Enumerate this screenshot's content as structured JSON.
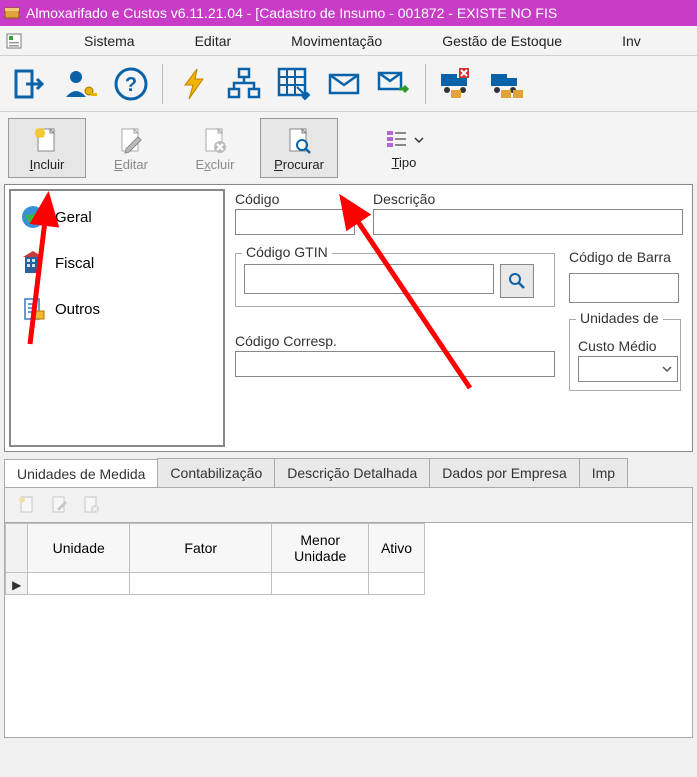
{
  "window": {
    "title": "Almoxarifado e Custos v6.11.21.04 - [Cadastro de Insumo - 001872 - EXISTE NO FIS"
  },
  "menubar": {
    "items": [
      "Sistema",
      "Editar",
      "Movimentação",
      "Gestão de Estoque",
      "Inv"
    ]
  },
  "action_toolbar": {
    "incluir": "Incluir",
    "editar": "Editar",
    "excluir": "Excluir",
    "procurar": "Procurar",
    "tipo": "Tipo"
  },
  "sidebar": {
    "items": [
      {
        "label": "Geral",
        "icon": "globe"
      },
      {
        "label": "Fiscal",
        "icon": "building"
      },
      {
        "label": "Outros",
        "icon": "document"
      }
    ]
  },
  "form": {
    "codigo_label": "Código",
    "descricao_label": "Descrição",
    "codigo_gtin_label": "Código GTIN",
    "codigo_barra_label": "Código de Barra",
    "unidades_de_label": "Unidades de ",
    "codigo_corresp_label": "Código Corresp.",
    "custo_medio_label": "Custo Médio",
    "codigo_value": "",
    "descricao_value": "",
    "gtin_value": "",
    "barra_value": "",
    "corresp_value": "",
    "custo_medio_value": ""
  },
  "tabs": {
    "items": [
      "Unidades de Medida",
      "Contabilização",
      "Descrição Detalhada",
      "Dados por Empresa",
      "Imp"
    ],
    "active_index": 0
  },
  "grid": {
    "columns": [
      "Unidade",
      "Fator",
      "Menor Unidade",
      "Ativo"
    ],
    "rows": [
      {
        "unidade": "",
        "fator": "",
        "menor_unidade": "",
        "ativo": ""
      }
    ]
  },
  "colors": {
    "titlebar": "#c83cc8",
    "accent": "#0a62a8",
    "annotation": "#ff0000"
  }
}
